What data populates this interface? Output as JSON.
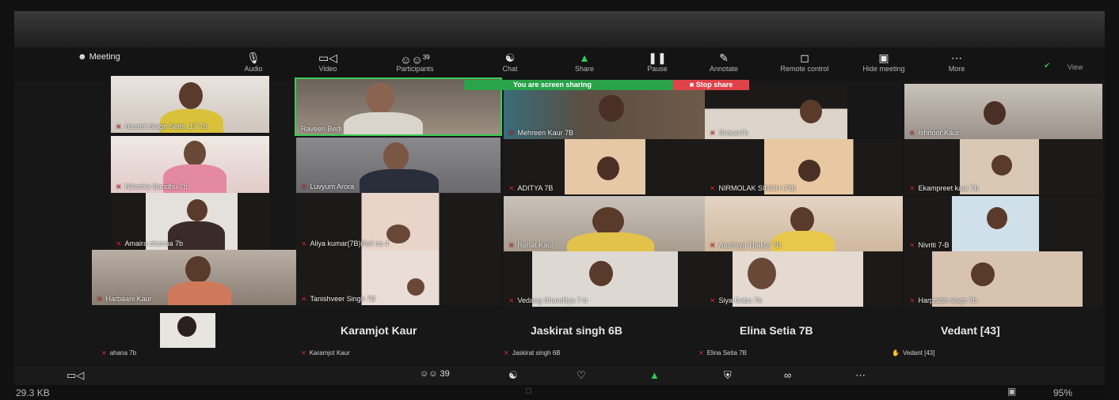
{
  "toolbar": {
    "meeting_label": "Meeting",
    "items": [
      {
        "label": "Audio",
        "icon": "microphone-icon"
      },
      {
        "label": "Video",
        "icon": "video-camera-icon"
      },
      {
        "label": "Participants",
        "icon": "participants-icon",
        "count": "39"
      },
      {
        "label": "Chat",
        "icon": "chat-icon"
      },
      {
        "label": "Share",
        "icon": "share-icon"
      },
      {
        "label": "Pause",
        "icon": "pause-icon"
      },
      {
        "label": "Annotate",
        "icon": "annotate-icon"
      },
      {
        "label": "Remote control",
        "icon": "remote-control-icon"
      },
      {
        "label": "Hide meeting",
        "icon": "hide-meeting-icon"
      },
      {
        "label": "More",
        "icon": "more-icon"
      }
    ],
    "view_label": "View"
  },
  "share_bar": {
    "message": "You are screen sharing",
    "stop_label": "Stop share"
  },
  "participants": [
    {
      "name": "Harshil Singh Sethi ,17 7b"
    },
    {
      "name": "Raveen Bedi"
    },
    {
      "name": "Mehreen Kaur 7B"
    },
    {
      "name": "Sivkan7b"
    },
    {
      "name": "Ishnoor Kaur"
    },
    {
      "name": "Niharika Bandhu 7b"
    },
    {
      "name": "Luvyum Arora"
    },
    {
      "name": "ADITYA 7B"
    },
    {
      "name": "NIRMOLAK SINGH (7B)"
    },
    {
      "name": "Ekampreet kaur  7b"
    },
    {
      "name": "Amaira sharma 7b"
    },
    {
      "name": "Aliya kumar(7B)Roll no 4"
    },
    {
      "name": "Rehat Kaur"
    },
    {
      "name": "Aashirya  Thakur 7B"
    },
    {
      "name": "Nivriti 7-B"
    },
    {
      "name": "Harbaani Kaur"
    },
    {
      "name": "Tanishveer Singh 7B"
    },
    {
      "name": "Vedang Shandilya 7-b"
    },
    {
      "name": "Siya Gaba 7b"
    },
    {
      "name": "Harprabh singh 7b"
    },
    {
      "name": "ahana 7b"
    }
  ],
  "no_video": [
    {
      "display": "Karamjot Kaur",
      "label": "Karamjot Kaur"
    },
    {
      "display": "Jaskirat singh 6B",
      "label": "Jaskirat singh 6B"
    },
    {
      "display": "Elina Setia 7B",
      "label": "Elina Setia 7B"
    },
    {
      "display": "Vedant [43]",
      "label": "Vedant [43]"
    }
  ],
  "bottom_bar": {
    "participants_count": "39"
  },
  "status_bar": {
    "file_size": "29.3 KB",
    "zoom": "95%"
  }
}
